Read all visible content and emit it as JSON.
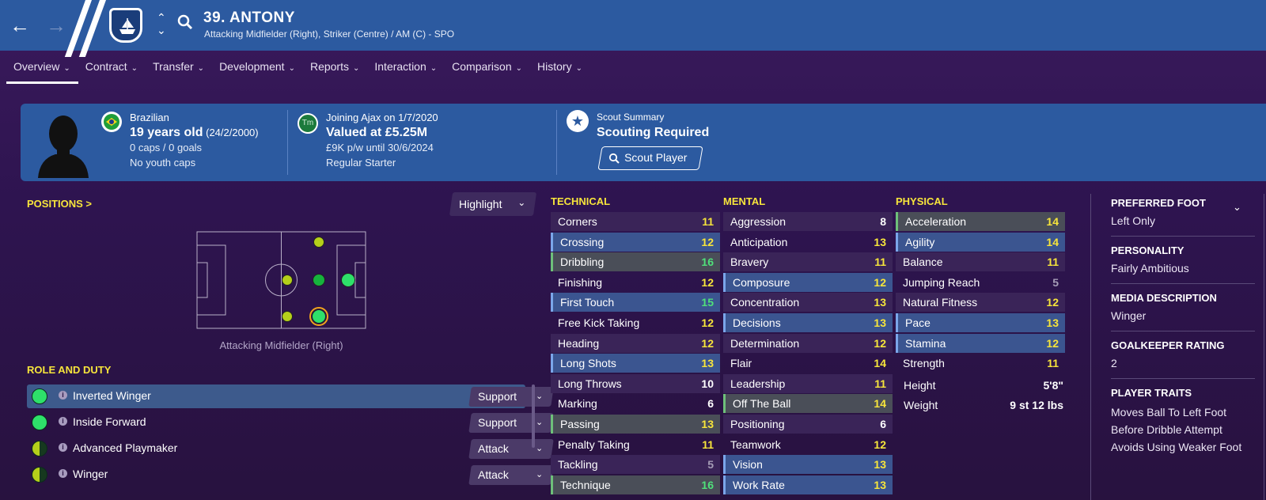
{
  "header": {
    "name": "39. ANTONY",
    "subtitle": "Attacking Midfielder (Right), Striker (Centre) / AM (C) - SPO"
  },
  "tabs": [
    {
      "label": "Overview"
    },
    {
      "label": "Contract"
    },
    {
      "label": "Transfer"
    },
    {
      "label": "Development"
    },
    {
      "label": "Reports"
    },
    {
      "label": "Interaction"
    },
    {
      "label": "Comparison"
    },
    {
      "label": "History"
    }
  ],
  "summary": {
    "nationality": "Brazilian",
    "age": "19 years old",
    "dob": "(24/2/2000)",
    "caps": "0 caps / 0 goals",
    "youth_caps": "No youth caps",
    "joining": "Joining Ajax on 1/7/2020",
    "value": "Valued at £5.25M",
    "wage": "£9K p/w until 30/6/2024",
    "status": "Regular Starter",
    "tm_logo_text": "Tm",
    "scout_label": "Scout Summary",
    "scout_status": "Scouting Required",
    "scout_button": "Scout Player"
  },
  "positions": {
    "title": "POSITIONS >",
    "highlight": "Highlight",
    "position_label": "Attacking Midfielder (Right)"
  },
  "roles": {
    "title": "ROLE AND DUTY",
    "items": [
      {
        "name": "Inverted Winger",
        "duty": "Support",
        "fit": "full",
        "selected": true
      },
      {
        "name": "Inside Forward",
        "duty": "Support",
        "fit": "full",
        "selected": false
      },
      {
        "name": "Advanced Playmaker",
        "duty": "Attack",
        "fit": "half",
        "selected": false
      },
      {
        "name": "Winger",
        "duty": "Attack",
        "fit": "half",
        "selected": false
      }
    ]
  },
  "attributes": {
    "technical_title": "TECHNICAL",
    "mental_title": "MENTAL",
    "physical_title": "PHYSICAL",
    "technical": [
      {
        "name": "Corners",
        "value": "11"
      },
      {
        "name": "Crossing",
        "value": "12"
      },
      {
        "name": "Dribbling",
        "value": "16"
      },
      {
        "name": "Finishing",
        "value": "12"
      },
      {
        "name": "First Touch",
        "value": "15"
      },
      {
        "name": "Free Kick Taking",
        "value": "12"
      },
      {
        "name": "Heading",
        "value": "12"
      },
      {
        "name": "Long Shots",
        "value": "13"
      },
      {
        "name": "Long Throws",
        "value": "10"
      },
      {
        "name": "Marking",
        "value": "6"
      },
      {
        "name": "Passing",
        "value": "13"
      },
      {
        "name": "Penalty Taking",
        "value": "11"
      },
      {
        "name": "Tackling",
        "value": "5"
      },
      {
        "name": "Technique",
        "value": "16"
      }
    ],
    "mental": [
      {
        "name": "Aggression",
        "value": "8"
      },
      {
        "name": "Anticipation",
        "value": "13"
      },
      {
        "name": "Bravery",
        "value": "11"
      },
      {
        "name": "Composure",
        "value": "12"
      },
      {
        "name": "Concentration",
        "value": "13"
      },
      {
        "name": "Decisions",
        "value": "13"
      },
      {
        "name": "Determination",
        "value": "12"
      },
      {
        "name": "Flair",
        "value": "14"
      },
      {
        "name": "Leadership",
        "value": "11"
      },
      {
        "name": "Off The Ball",
        "value": "14"
      },
      {
        "name": "Positioning",
        "value": "6"
      },
      {
        "name": "Teamwork",
        "value": "12"
      },
      {
        "name": "Vision",
        "value": "13"
      },
      {
        "name": "Work Rate",
        "value": "13"
      }
    ],
    "physical": [
      {
        "name": "Acceleration",
        "value": "14"
      },
      {
        "name": "Agility",
        "value": "14"
      },
      {
        "name": "Balance",
        "value": "11"
      },
      {
        "name": "Jumping Reach",
        "value": "5"
      },
      {
        "name": "Natural Fitness",
        "value": "12"
      },
      {
        "name": "Pace",
        "value": "13"
      },
      {
        "name": "Stamina",
        "value": "12"
      },
      {
        "name": "Strength",
        "value": "11"
      }
    ],
    "height_label": "Height",
    "height": "5'8\"",
    "weight_label": "Weight",
    "weight": "9 st 12 lbs"
  },
  "info": {
    "preferred_foot_title": "PREFERRED FOOT",
    "preferred_foot": "Left Only",
    "personality_title": "PERSONALITY",
    "personality": "Fairly Ambitious",
    "media_title": "MEDIA DESCRIPTION",
    "media": "Winger",
    "gk_title": "GOALKEEPER RATING",
    "gk": "2",
    "traits_title": "PLAYER TRAITS",
    "traits": [
      "Moves Ball To Left Foot",
      "Before Dribble Attempt",
      "Avoids Using Weaker Foot"
    ]
  },
  "colors": {
    "header_blue": "#2c5aa0",
    "background_purple": "#2e1450",
    "section_yellow": "#f7e53b",
    "attr_green": "#4fe07a",
    "role_green": "#2ee06a"
  }
}
